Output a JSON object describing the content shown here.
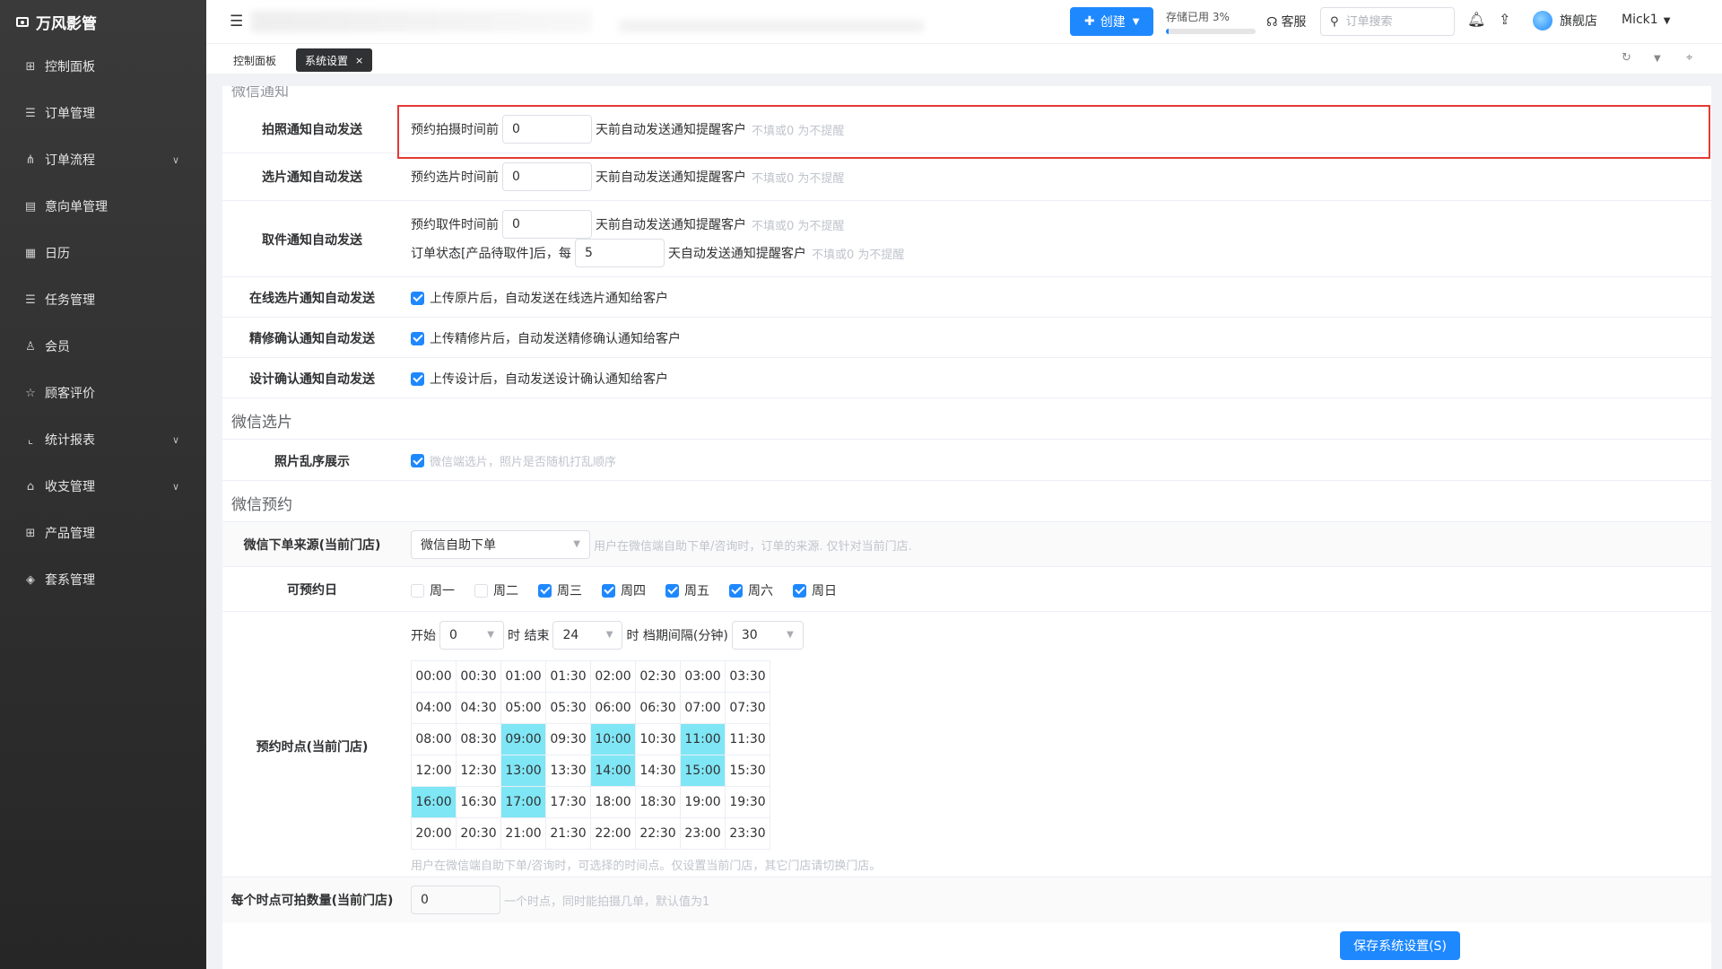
{
  "app": {
    "name": "万风影管"
  },
  "sidebar": {
    "items": [
      {
        "label": "控制面板",
        "icon": "dashboard-icon",
        "glyph": "⊞",
        "has_children": false
      },
      {
        "label": "订单管理",
        "icon": "list-icon",
        "glyph": "☰",
        "has_children": false
      },
      {
        "label": "订单流程",
        "icon": "flow-icon",
        "glyph": "⋔",
        "has_children": true
      },
      {
        "label": "意向单管理",
        "icon": "document-icon",
        "glyph": "▤",
        "has_children": false
      },
      {
        "label": "日历",
        "icon": "calendar-icon",
        "glyph": "▦",
        "has_children": false
      },
      {
        "label": "任务管理",
        "icon": "task-icon",
        "glyph": "☰",
        "has_children": false
      },
      {
        "label": "会员",
        "icon": "user-icon",
        "glyph": "♙",
        "has_children": false
      },
      {
        "label": "顾客评价",
        "icon": "star-icon",
        "glyph": "☆",
        "has_children": false
      },
      {
        "label": "统计报表",
        "icon": "chart-icon",
        "glyph": "⌞",
        "has_children": true
      },
      {
        "label": "收支管理",
        "icon": "bank-icon",
        "glyph": "⌂",
        "has_children": true
      },
      {
        "label": "产品管理",
        "icon": "grid-icon",
        "glyph": "⊞",
        "has_children": false
      },
      {
        "label": "套系管理",
        "icon": "package-icon",
        "glyph": "◈",
        "has_children": false
      }
    ]
  },
  "header": {
    "create_label": "创建",
    "storage_label": "存储已用 3%",
    "storage_used": 0.03,
    "service_label": "客服",
    "search_placeholder": "订单搜索",
    "shop_label": "旗舰店",
    "user_label": "Mick1"
  },
  "tabs": [
    {
      "label": "控制面板",
      "active": false
    },
    {
      "label": "系统设置",
      "active": true
    }
  ],
  "settings": {
    "cut_section_title": "微信通知",
    "photo_notify": {
      "label": "拍照通知自动发送",
      "prefix": "预约拍摄时间前",
      "value": "0",
      "suffix": "天前自动发送通知提醒客户",
      "hint": "不填或0 为不提醒"
    },
    "select_notify": {
      "label": "选片通知自动发送",
      "prefix": "预约选片时间前",
      "value": "0",
      "suffix": "天前自动发送通知提醒客户",
      "hint": "不填或0 为不提醒"
    },
    "pickup_notify": {
      "label": "取件通知自动发送",
      "prefix": "预约取件时间前",
      "value": "0",
      "suffix": "天前自动发送通知提醒客户",
      "hint": "不填或0 为不提醒",
      "prefix2": "订单状态[产品待取件]后，每",
      "value2": "5",
      "suffix2": "天自动发送通知提醒客户",
      "hint2": "不填或0 为不提醒"
    },
    "online_select_notify": {
      "label": "在线选片通知自动发送",
      "text": "上传原片后，自动发送在线选片通知给客户",
      "checked": true
    },
    "retouch_notify": {
      "label": "精修确认通知自动发送",
      "text": "上传精修片后，自动发送精修确认通知给客户",
      "checked": true
    },
    "design_notify": {
      "label": "设计确认通知自动发送",
      "text": "上传设计后，自动发送设计确认通知给客户",
      "checked": true
    },
    "wechat_select_title": "微信选片",
    "shuffle": {
      "label": "照片乱序展示",
      "text": "微信端选片，照片是否随机打乱顺序",
      "checked": true
    },
    "wechat_booking_title": "微信预约",
    "order_source": {
      "label": "微信下单来源(当前门店)",
      "value": "微信自助下单",
      "hint": "用户在微信端自助下单/咨询时，订单的来源. 仅针对当前门店."
    },
    "days": {
      "label": "可预约日",
      "items": [
        {
          "label": "周一",
          "checked": false
        },
        {
          "label": "周二",
          "checked": false
        },
        {
          "label": "周三",
          "checked": true
        },
        {
          "label": "周四",
          "checked": true
        },
        {
          "label": "周五",
          "checked": true
        },
        {
          "label": "周六",
          "checked": true
        },
        {
          "label": "周日",
          "checked": true
        }
      ]
    },
    "time_points": {
      "label": "预约时点(当前门店)",
      "start_label": "开始",
      "start_value": "0",
      "hour_end_label": "时 结束",
      "end_value": "24",
      "interval_label": "时 档期间隔(分钟)",
      "interval_value": "30",
      "rows": [
        [
          "00:00",
          "00:30",
          "01:00",
          "01:30",
          "02:00",
          "02:30",
          "03:00",
          "03:30"
        ],
        [
          "04:00",
          "04:30",
          "05:00",
          "05:30",
          "06:00",
          "06:30",
          "07:00",
          "07:30"
        ],
        [
          "08:00",
          "08:30",
          "09:00",
          "09:30",
          "10:00",
          "10:30",
          "11:00",
          "11:30"
        ],
        [
          "12:00",
          "12:30",
          "13:00",
          "13:30",
          "14:00",
          "14:30",
          "15:00",
          "15:30"
        ],
        [
          "16:00",
          "16:30",
          "17:00",
          "17:30",
          "18:00",
          "18:30",
          "19:00",
          "19:30"
        ],
        [
          "20:00",
          "20:30",
          "21:00",
          "21:30",
          "22:00",
          "22:30",
          "23:00",
          "23:30"
        ]
      ],
      "selected": [
        "09:00",
        "10:00",
        "11:00",
        "13:00",
        "14:00",
        "15:00",
        "16:00",
        "17:00"
      ],
      "hint": "用户在微信端自助下单/咨询时，可选择的时间点。仅设置当前门店，其它门店请切换门店。"
    },
    "capacity": {
      "label": "每个时点可拍数量(当前门店)",
      "value": "0",
      "hint": "一个时点，同时能拍摄几单，默认值为1"
    }
  },
  "save_label": "保存系统设置(S)",
  "colors": {
    "primary": "#1e88ff",
    "highlight": "#7fe6f5",
    "annotation": "#e53935"
  }
}
